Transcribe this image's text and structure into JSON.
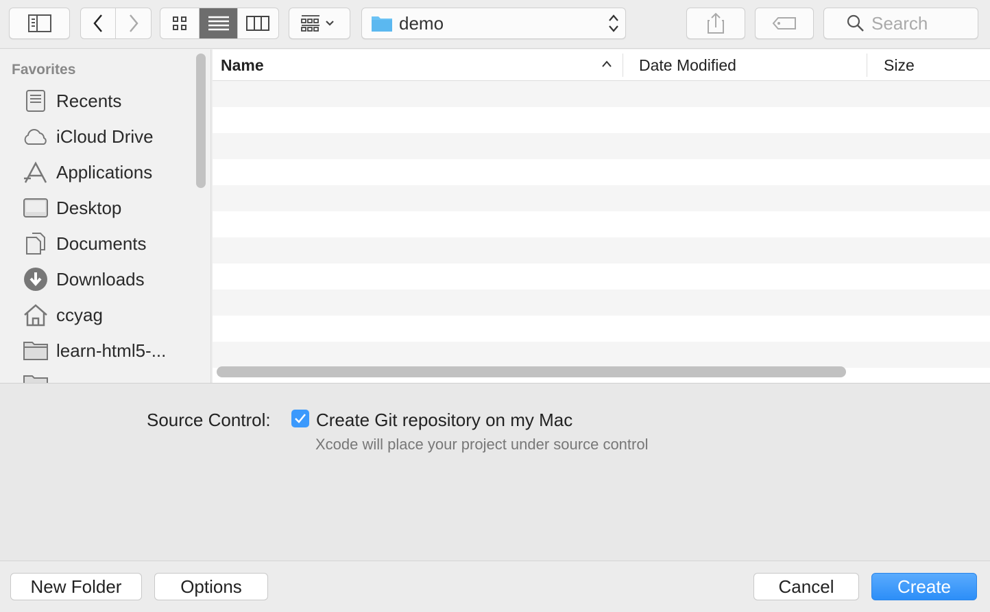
{
  "toolbar": {
    "location": "demo",
    "search_placeholder": "Search",
    "view_mode": "list"
  },
  "sidebar": {
    "section": "Favorites",
    "items": [
      {
        "label": "Recents",
        "icon": "recents-icon"
      },
      {
        "label": "iCloud Drive",
        "icon": "cloud-icon"
      },
      {
        "label": "Applications",
        "icon": "applications-icon"
      },
      {
        "label": "Desktop",
        "icon": "desktop-icon"
      },
      {
        "label": "Documents",
        "icon": "documents-icon"
      },
      {
        "label": "Downloads",
        "icon": "downloads-icon"
      },
      {
        "label": "ccyag",
        "icon": "home-icon"
      },
      {
        "label": "learn-html5-...",
        "icon": "folder-icon"
      }
    ]
  },
  "file_list": {
    "columns": [
      "Name",
      "Date Modified",
      "Size"
    ],
    "sort_column": "Name",
    "sort": "ascending"
  },
  "source_control": {
    "label": "Source Control:",
    "checkbox_label": "Create Git repository on my Mac",
    "checked": true,
    "hint": "Xcode will place your project under source control"
  },
  "footer": {
    "new_folder": "New Folder",
    "options": "Options",
    "cancel": "Cancel",
    "create": "Create"
  },
  "colors": {
    "accent": "#3b99fc"
  }
}
